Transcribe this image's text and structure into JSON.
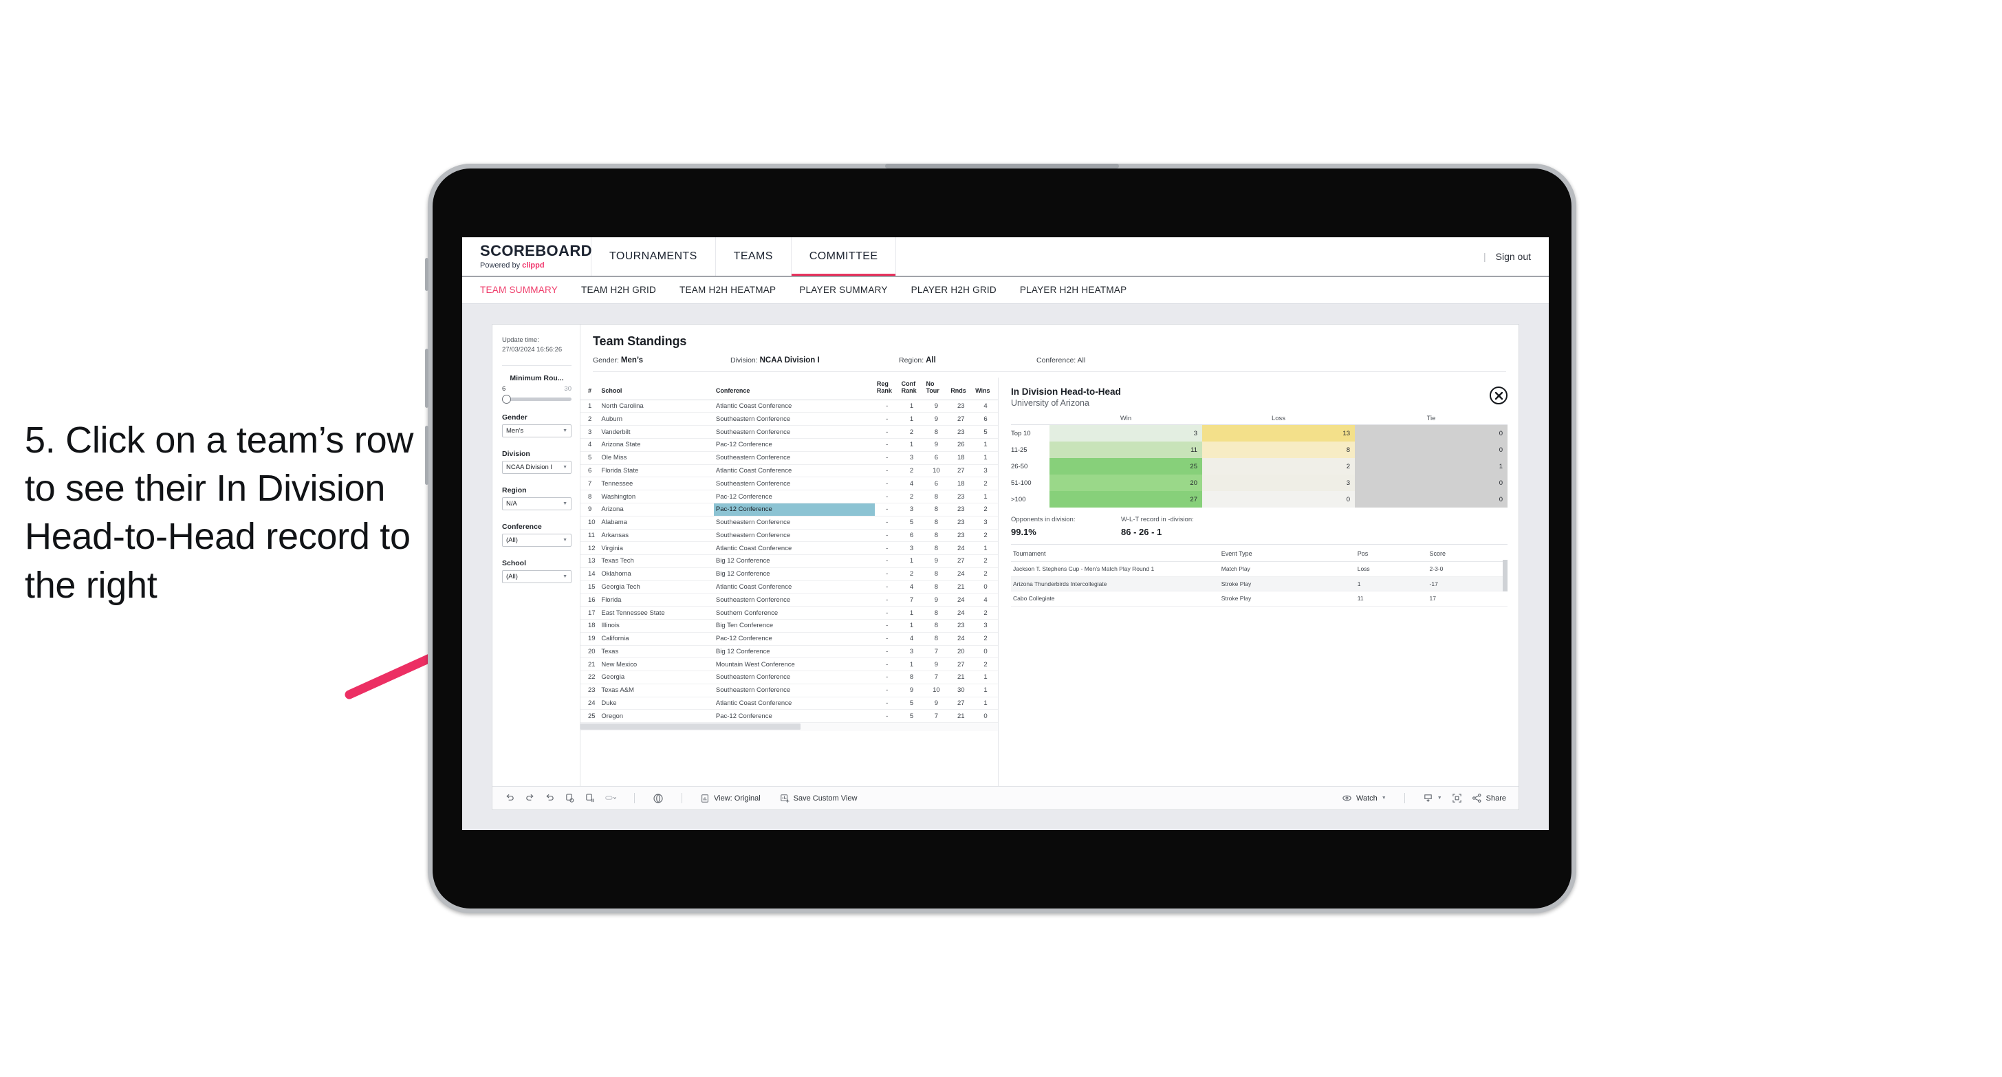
{
  "annotation": {
    "text": "5. Click on a team’s row to see their In Division Head-to-Head record to the right",
    "arrow_color": "#ec2f63"
  },
  "app": {
    "brand": {
      "title": "SCOREBOARD",
      "powered_prefix": "Powered by ",
      "powered_name": "clippd"
    },
    "nav": [
      {
        "label": "TOURNAMENTS",
        "active": false
      },
      {
        "label": "TEAMS",
        "active": false
      },
      {
        "label": "COMMITTEE",
        "active": true
      }
    ],
    "header_right": {
      "divider": "|",
      "sign_out": "Sign out"
    },
    "subtabs": [
      {
        "label": "TEAM SUMMARY",
        "active": true
      },
      {
        "label": "TEAM H2H GRID",
        "active": false
      },
      {
        "label": "TEAM H2H HEATMAP",
        "active": false
      },
      {
        "label": "PLAYER SUMMARY",
        "active": false
      },
      {
        "label": "PLAYER H2H GRID",
        "active": false
      },
      {
        "label": "PLAYER H2H HEATMAP",
        "active": false
      }
    ]
  },
  "filters": {
    "update_label": "Update time:",
    "update_value": "27/03/2024 16:56:26",
    "slider": {
      "title": "Minimum Rou...",
      "min": "6",
      "max": "30"
    },
    "gender": {
      "label": "Gender",
      "value": "Men’s"
    },
    "division": {
      "label": "Division",
      "value": "NCAA Division I"
    },
    "region": {
      "label": "Region",
      "value": "N/A"
    },
    "conference": {
      "label": "Conference",
      "value": "(All)"
    },
    "school": {
      "label": "School",
      "value": "(All)"
    }
  },
  "standings": {
    "title": "Team Standings",
    "meta": [
      {
        "key": "Gender: ",
        "value": "Men’s",
        "bold": true
      },
      {
        "key": "Division: ",
        "value": "NCAA Division I",
        "bold": true
      },
      {
        "key": "Region: ",
        "value": "All",
        "bold": true
      },
      {
        "key": "Conference: ",
        "value": "All",
        "bold": false
      }
    ],
    "columns": [
      "#",
      "School",
      "Conference",
      "Reg Rank",
      "Conf Rank",
      "No Tour",
      "Rnds",
      "Wins"
    ],
    "columns_split": [
      {
        "l1": "#",
        "l2": ""
      },
      {
        "l1": "School",
        "l2": ""
      },
      {
        "l1": "Conference",
        "l2": ""
      },
      {
        "l1": "Reg",
        "l2": "Rank"
      },
      {
        "l1": "Conf",
        "l2": "Rank"
      },
      {
        "l1": "No",
        "l2": "Tour"
      },
      {
        "l1": "Rnds",
        "l2": ""
      },
      {
        "l1": "Wins",
        "l2": ""
      }
    ],
    "selected_row": 9,
    "rows": [
      {
        "n": "1",
        "school": "North Carolina",
        "conf": "Atlantic Coast Conference",
        "reg": "-",
        "cr": "1",
        "nt": "9",
        "rnds": "23",
        "wins": "4"
      },
      {
        "n": "2",
        "school": "Auburn",
        "conf": "Southeastern Conference",
        "reg": "-",
        "cr": "1",
        "nt": "9",
        "rnds": "27",
        "wins": "6"
      },
      {
        "n": "3",
        "school": "Vanderbilt",
        "conf": "Southeastern Conference",
        "reg": "-",
        "cr": "2",
        "nt": "8",
        "rnds": "23",
        "wins": "5"
      },
      {
        "n": "4",
        "school": "Arizona State",
        "conf": "Pac-12 Conference",
        "reg": "-",
        "cr": "1",
        "nt": "9",
        "rnds": "26",
        "wins": "1"
      },
      {
        "n": "5",
        "school": "Ole Miss",
        "conf": "Southeastern Conference",
        "reg": "-",
        "cr": "3",
        "nt": "6",
        "rnds": "18",
        "wins": "1"
      },
      {
        "n": "6",
        "school": "Florida State",
        "conf": "Atlantic Coast Conference",
        "reg": "-",
        "cr": "2",
        "nt": "10",
        "rnds": "27",
        "wins": "3"
      },
      {
        "n": "7",
        "school": "Tennessee",
        "conf": "Southeastern Conference",
        "reg": "-",
        "cr": "4",
        "nt": "6",
        "rnds": "18",
        "wins": "2"
      },
      {
        "n": "8",
        "school": "Washington",
        "conf": "Pac-12 Conference",
        "reg": "-",
        "cr": "2",
        "nt": "8",
        "rnds": "23",
        "wins": "1"
      },
      {
        "n": "9",
        "school": "Arizona",
        "conf": "Pac-12 Conference",
        "reg": "-",
        "cr": "3",
        "nt": "8",
        "rnds": "23",
        "wins": "2"
      },
      {
        "n": "10",
        "school": "Alabama",
        "conf": "Southeastern Conference",
        "reg": "-",
        "cr": "5",
        "nt": "8",
        "rnds": "23",
        "wins": "3"
      },
      {
        "n": "11",
        "school": "Arkansas",
        "conf": "Southeastern Conference",
        "reg": "-",
        "cr": "6",
        "nt": "8",
        "rnds": "23",
        "wins": "2"
      },
      {
        "n": "12",
        "school": "Virginia",
        "conf": "Atlantic Coast Conference",
        "reg": "-",
        "cr": "3",
        "nt": "8",
        "rnds": "24",
        "wins": "1"
      },
      {
        "n": "13",
        "school": "Texas Tech",
        "conf": "Big 12 Conference",
        "reg": "-",
        "cr": "1",
        "nt": "9",
        "rnds": "27",
        "wins": "2"
      },
      {
        "n": "14",
        "school": "Oklahoma",
        "conf": "Big 12 Conference",
        "reg": "-",
        "cr": "2",
        "nt": "8",
        "rnds": "24",
        "wins": "2"
      },
      {
        "n": "15",
        "school": "Georgia Tech",
        "conf": "Atlantic Coast Conference",
        "reg": "-",
        "cr": "4",
        "nt": "8",
        "rnds": "21",
        "wins": "0"
      },
      {
        "n": "16",
        "school": "Florida",
        "conf": "Southeastern Conference",
        "reg": "-",
        "cr": "7",
        "nt": "9",
        "rnds": "24",
        "wins": "4"
      },
      {
        "n": "17",
        "school": "East Tennessee State",
        "conf": "Southern Conference",
        "reg": "-",
        "cr": "1",
        "nt": "8",
        "rnds": "24",
        "wins": "2"
      },
      {
        "n": "18",
        "school": "Illinois",
        "conf": "Big Ten Conference",
        "reg": "-",
        "cr": "1",
        "nt": "8",
        "rnds": "23",
        "wins": "3"
      },
      {
        "n": "19",
        "school": "California",
        "conf": "Pac-12 Conference",
        "reg": "-",
        "cr": "4",
        "nt": "8",
        "rnds": "24",
        "wins": "2"
      },
      {
        "n": "20",
        "school": "Texas",
        "conf": "Big 12 Conference",
        "reg": "-",
        "cr": "3",
        "nt": "7",
        "rnds": "20",
        "wins": "0"
      },
      {
        "n": "21",
        "school": "New Mexico",
        "conf": "Mountain West Conference",
        "reg": "-",
        "cr": "1",
        "nt": "9",
        "rnds": "27",
        "wins": "2"
      },
      {
        "n": "22",
        "school": "Georgia",
        "conf": "Southeastern Conference",
        "reg": "-",
        "cr": "8",
        "nt": "7",
        "rnds": "21",
        "wins": "1"
      },
      {
        "n": "23",
        "school": "Texas A&M",
        "conf": "Southeastern Conference",
        "reg": "-",
        "cr": "9",
        "nt": "10",
        "rnds": "30",
        "wins": "1"
      },
      {
        "n": "24",
        "school": "Duke",
        "conf": "Atlantic Coast Conference",
        "reg": "-",
        "cr": "5",
        "nt": "9",
        "rnds": "27",
        "wins": "1"
      },
      {
        "n": "25",
        "school": "Oregon",
        "conf": "Pac-12 Conference",
        "reg": "-",
        "cr": "5",
        "nt": "7",
        "rnds": "21",
        "wins": "0"
      }
    ]
  },
  "detail": {
    "title": "In Division Head-to-Head",
    "subtitle": "University of Arizona",
    "close_icon": "close-icon",
    "heatmap": {
      "columns": [
        "Win",
        "Loss",
        "Tie"
      ],
      "rows": [
        {
          "label": "Top 10",
          "win": "3",
          "loss": "13",
          "tie": "0",
          "win_color": "#e3eee1",
          "loss_color": "#f3e08a",
          "tie_color": "#d0d0d0"
        },
        {
          "label": "11-25",
          "win": "11",
          "loss": "8",
          "tie": "0",
          "win_color": "#c8e3b9",
          "loss_color": "#f7ecc4",
          "tie_color": "#d0d0d0"
        },
        {
          "label": "26-50",
          "win": "25",
          "loss": "2",
          "tie": "1",
          "win_color": "#87d07a",
          "loss_color": "#f0efe8",
          "tie_color": "#d0d0d0"
        },
        {
          "label": "51-100",
          "win": "20",
          "loss": "3",
          "tie": "0",
          "win_color": "#9ad889",
          "loss_color": "#efeee6",
          "tie_color": "#d0d0d0"
        },
        {
          "label": ">100",
          "win": "27",
          "loss": "0",
          "tie": "0",
          "win_color": "#87d07a",
          "loss_color": "#f2f2ef",
          "tie_color": "#d0d0d0"
        }
      ]
    },
    "stats": [
      {
        "key": "Opponents in division:",
        "value": "99.1%"
      },
      {
        "key": "W-L-T record in -division:",
        "value": "86 - 26 - 1"
      }
    ],
    "events": {
      "columns": [
        "Tournament",
        "Event Type",
        "Pos",
        "Score"
      ],
      "rows": [
        {
          "tournament": "Jackson T. Stephens Cup - Men’s Match Play Round 1",
          "event_type": "Match Play",
          "pos": "Loss",
          "score": "2-3-0"
        },
        {
          "tournament": "Arizona Thunderbirds Intercollegiate",
          "event_type": "Stroke Play",
          "pos": "1",
          "score": "-17"
        },
        {
          "tournament": "Cabo Collegiate",
          "event_type": "Stroke Play",
          "pos": "11",
          "score": "17"
        }
      ]
    }
  },
  "toolbar": {
    "view_label": "View: Original",
    "save_label": "Save Custom View",
    "watch_label": "Watch",
    "share_label": "Share"
  }
}
